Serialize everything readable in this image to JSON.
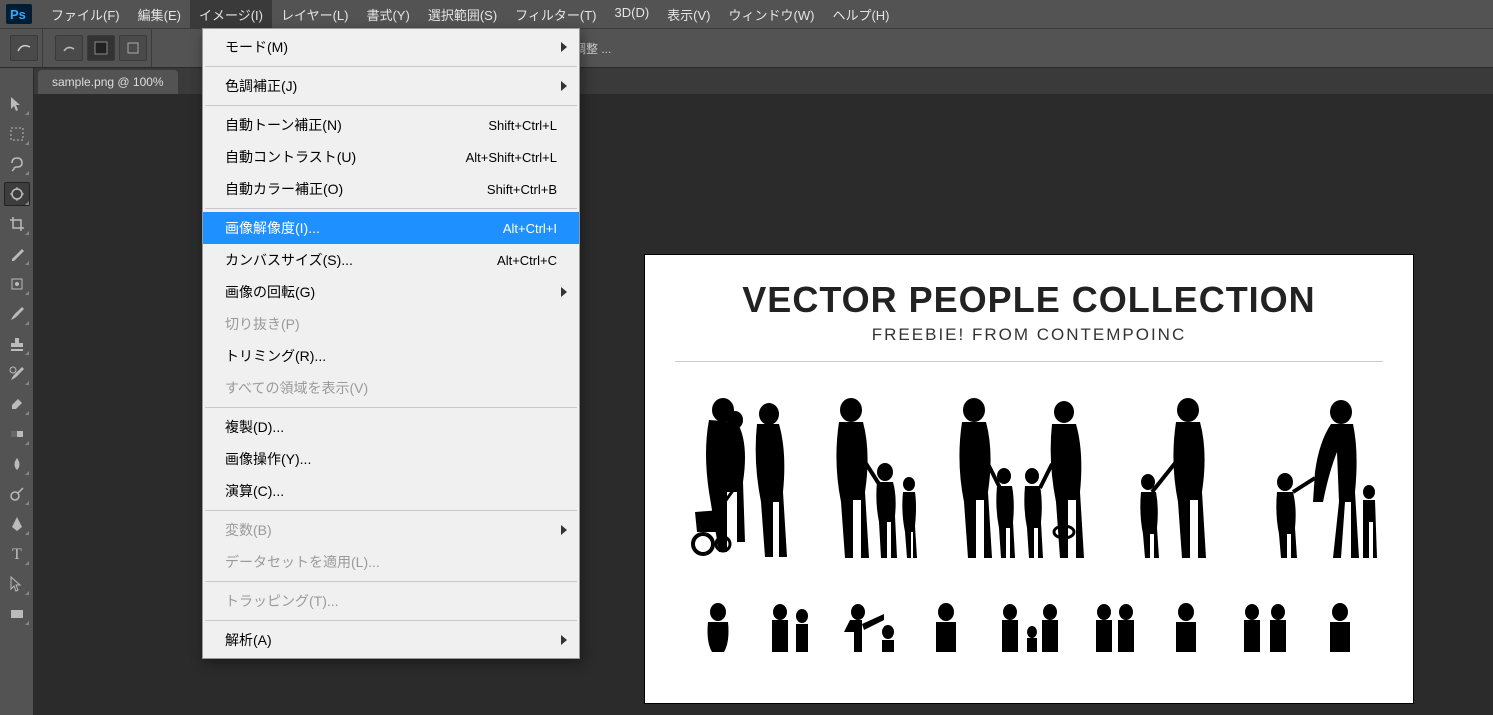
{
  "menubar": {
    "items": [
      "ファイル(F)",
      "編集(E)",
      "イメージ(I)",
      "レイヤー(L)",
      "書式(Y)",
      "選択範囲(S)",
      "フィルター(T)",
      "3D(D)",
      "表示(V)",
      "ウィンドウ(W)",
      "ヘルプ(H)"
    ],
    "open_index": 2
  },
  "optionsbar": {
    "adjust_label": "調整 ..."
  },
  "tab": {
    "title": "sample.png @ 100%"
  },
  "dropdown": {
    "groups": [
      [
        {
          "label": "モード(M)",
          "shortcut": "",
          "sub": true
        }
      ],
      [
        {
          "label": "色調補正(J)",
          "shortcut": "",
          "sub": true
        }
      ],
      [
        {
          "label": "自動トーン補正(N)",
          "shortcut": "Shift+Ctrl+L"
        },
        {
          "label": "自動コントラスト(U)",
          "shortcut": "Alt+Shift+Ctrl+L"
        },
        {
          "label": "自動カラー補正(O)",
          "shortcut": "Shift+Ctrl+B"
        }
      ],
      [
        {
          "label": "画像解像度(I)...",
          "shortcut": "Alt+Ctrl+I",
          "highlight": true
        },
        {
          "label": "カンバスサイズ(S)...",
          "shortcut": "Alt+Ctrl+C"
        },
        {
          "label": "画像の回転(G)",
          "shortcut": "",
          "sub": true
        },
        {
          "label": "切り抜き(P)",
          "shortcut": "",
          "disabled": true
        },
        {
          "label": "トリミング(R)...",
          "shortcut": ""
        },
        {
          "label": "すべての領域を表示(V)",
          "shortcut": "",
          "disabled": true
        }
      ],
      [
        {
          "label": "複製(D)...",
          "shortcut": ""
        },
        {
          "label": "画像操作(Y)...",
          "shortcut": ""
        },
        {
          "label": "演算(C)...",
          "shortcut": ""
        }
      ],
      [
        {
          "label": "変数(B)",
          "shortcut": "",
          "sub": true,
          "disabled": true
        },
        {
          "label": "データセットを適用(L)...",
          "shortcut": "",
          "disabled": true
        }
      ],
      [
        {
          "label": "トラッピング(T)...",
          "shortcut": "",
          "disabled": true
        }
      ],
      [
        {
          "label": "解析(A)",
          "shortcut": "",
          "sub": true
        }
      ]
    ]
  },
  "canvas": {
    "title": "VECTOR PEOPLE COLLECTION",
    "subtitle": "FREEBIE! FROM CONTEMPOINC"
  },
  "tools": [
    "move-tool",
    "marquee-tool",
    "lasso-tool",
    "quick-select-tool",
    "crop-tool",
    "eyedropper-tool",
    "spot-heal-tool",
    "brush-tool",
    "stamp-tool",
    "history-brush-tool",
    "eraser-tool",
    "gradient-tool",
    "blur-tool",
    "dodge-tool",
    "pen-tool",
    "type-tool",
    "path-select-tool",
    "rectangle-tool"
  ],
  "tool_selected_index": 3
}
